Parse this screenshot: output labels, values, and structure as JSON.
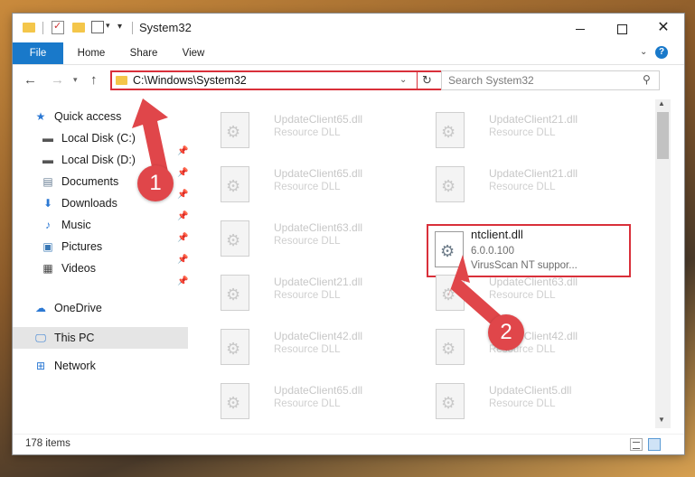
{
  "window": {
    "title": "System32"
  },
  "ribbon": {
    "tabs": [
      "File",
      "Home",
      "Share",
      "View"
    ]
  },
  "address_bar": {
    "path": "C:\\Windows\\System32"
  },
  "search": {
    "placeholder": "Search System32"
  },
  "sidebar": {
    "items": [
      {
        "label": "Quick access",
        "icon": "star-icon"
      },
      {
        "label": "Local Disk (C:)",
        "icon": "drive-icon"
      },
      {
        "label": "Local Disk (D:)",
        "icon": "drive-icon"
      },
      {
        "label": "Documents",
        "icon": "documents-icon"
      },
      {
        "label": "Downloads",
        "icon": "download-icon"
      },
      {
        "label": "Music",
        "icon": "music-icon"
      },
      {
        "label": "Pictures",
        "icon": "pictures-icon"
      },
      {
        "label": "Videos",
        "icon": "videos-icon"
      },
      {
        "label": "OneDrive",
        "icon": "cloud-icon"
      },
      {
        "label": "This PC",
        "icon": "computer-icon"
      },
      {
        "label": "Network",
        "icon": "network-icon"
      }
    ],
    "selected": "This PC"
  },
  "files": {
    "left": [
      {
        "name": "UpdateClient65.dll",
        "type": "Resource DLL"
      },
      {
        "name": "UpdateClient65.dll",
        "type": "Resource DLL"
      },
      {
        "name": "UpdateClient63.dll",
        "type": "Resource DLL"
      },
      {
        "name": "UpdateClient21.dll",
        "type": "Resource DLL"
      },
      {
        "name": "UpdateClient42.dll",
        "type": "Resource DLL"
      },
      {
        "name": "UpdateClient65.dll",
        "type": "Resource DLL"
      }
    ],
    "right": [
      {
        "name": "UpdateClient21.dll",
        "type": "Resource DLL"
      },
      {
        "name": "UpdateClient21.dll",
        "type": "Resource DLL"
      },
      {
        "name": "UpdateClient63.dll",
        "type": "Resource DLL"
      },
      {
        "name": "UpdateClient42.dll",
        "type": "Resource DLL"
      },
      {
        "name": "UpdateClient5.dll",
        "type": "Resource DLL"
      }
    ],
    "highlighted": {
      "name": "ntclient.dll",
      "version": "6.0.0.100",
      "description": "VirusScan NT suppor..."
    }
  },
  "status": {
    "item_count": "178 items"
  },
  "annotations": {
    "step1": "1",
    "step2": "2",
    "color": "#e0464a"
  }
}
